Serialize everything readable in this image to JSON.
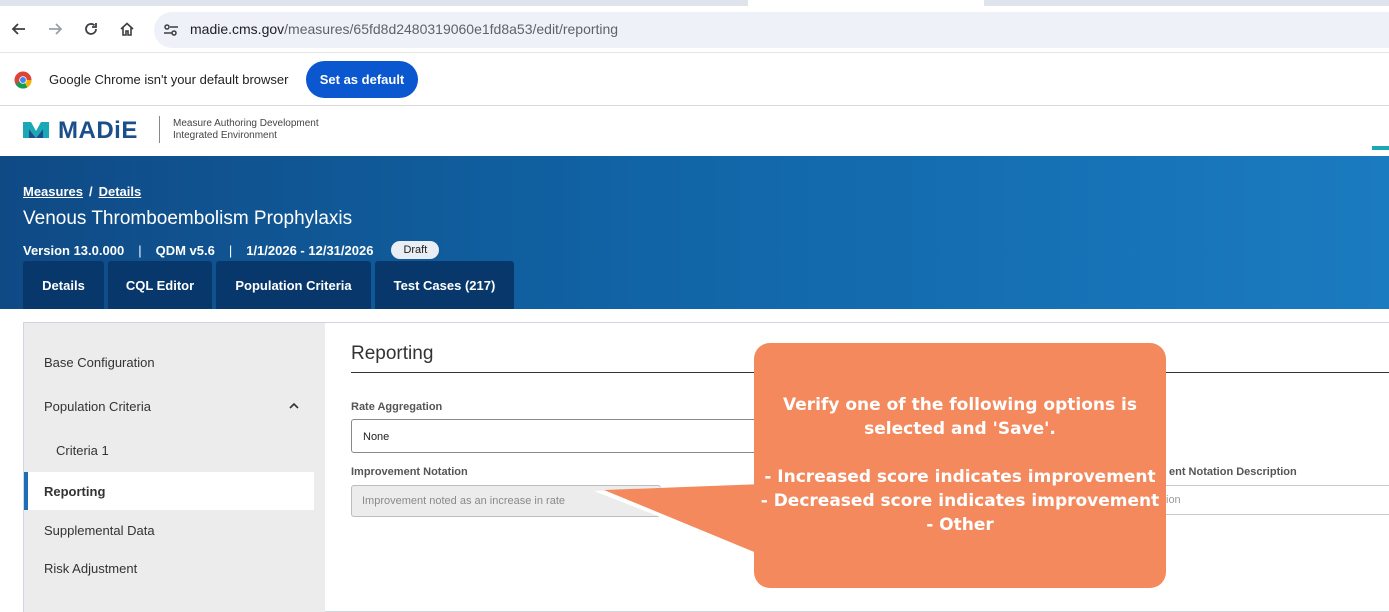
{
  "browser": {
    "url_host": "madie.cms.gov",
    "url_path": "/measures/65fd8d2480319060e1fd8a53/edit/reporting",
    "infobar_message": "Google Chrome isn't your default browser",
    "infobar_button": "Set as default"
  },
  "brand": {
    "name": "MADiE",
    "tagline_line1": "Measure Authoring Development",
    "tagline_line2": "Integrated Environment",
    "accent_color": "#1ba8b6",
    "primary_color": "#1a4f8b"
  },
  "banner": {
    "breadcrumb": [
      "Measures",
      "Details"
    ],
    "breadcrumb_separator": "/",
    "title": "Venous Thromboembolism Prophylaxis",
    "version": "Version 13.0.000",
    "model": "QDM v5.6",
    "period": "1/1/2026 - 12/31/2026",
    "status": "Draft",
    "separator": "|",
    "tabs": [
      {
        "label": "Details"
      },
      {
        "label": "CQL Editor"
      },
      {
        "label": "Population Criteria"
      },
      {
        "label": "Test Cases (217)"
      }
    ]
  },
  "sidebar": {
    "items": [
      {
        "label": "Base Configuration"
      },
      {
        "label": "Population Criteria",
        "expanded": true
      },
      {
        "label": "Criteria 1"
      },
      {
        "label": "Reporting",
        "active": true
      },
      {
        "label": "Supplemental Data"
      },
      {
        "label": "Risk Adjustment"
      }
    ]
  },
  "reporting": {
    "title": "Reporting",
    "rate_aggregation_label": "Rate Aggregation",
    "rate_aggregation_value": "None",
    "improvement_notation_label": "Improvement Notation",
    "improvement_notation_value": "Improvement noted as an increase in rate",
    "description_label_fragment": "ent Notation Description",
    "description_placeholder_fragment": "ion"
  },
  "callout": {
    "line1": "Verify one of the following options is",
    "line2": "selected and 'Save'.",
    "option1": "- Increased score indicates improvement",
    "option2": "- Decreased score indicates improvement",
    "option3": "- Other",
    "color": "#f4895e"
  }
}
